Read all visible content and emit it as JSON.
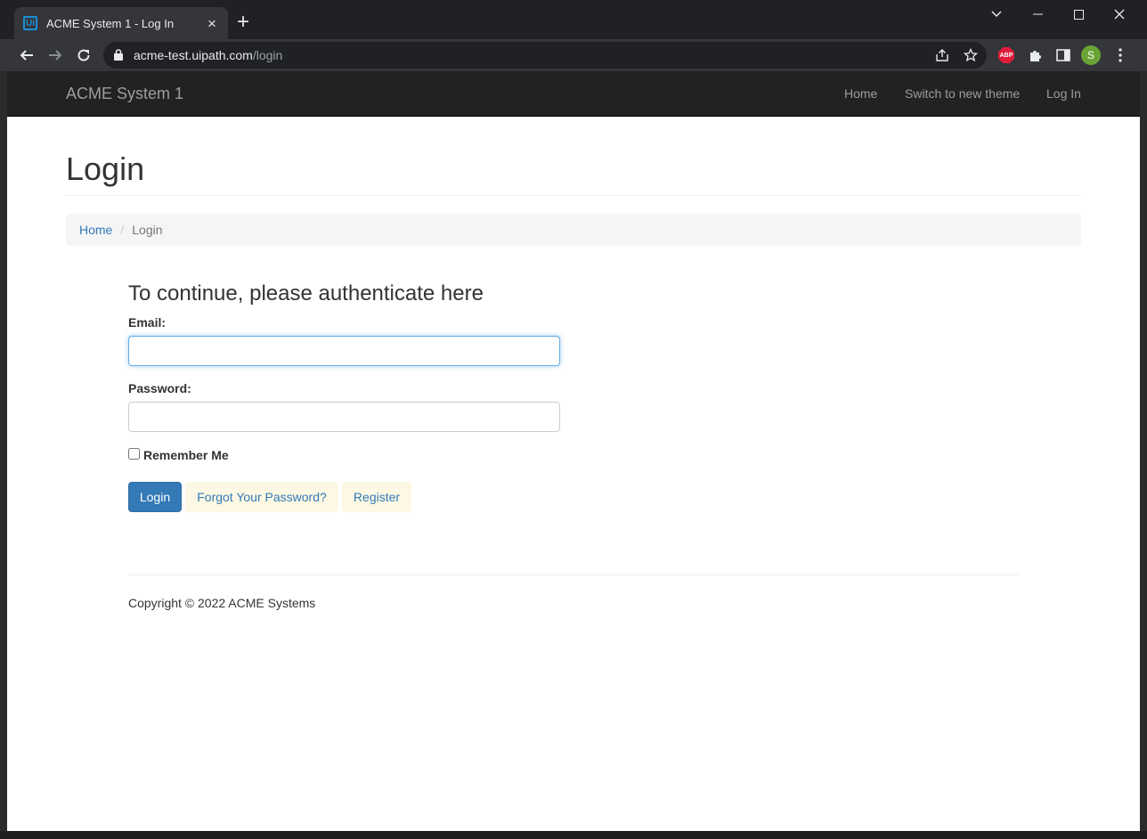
{
  "browser": {
    "tab_title": "ACME System 1 - Log In",
    "tab_favicon_text": "Ui",
    "url_host": "acme-test.uipath.com",
    "url_path": "/login",
    "profile_initial": "S",
    "adblock_label": "ABP"
  },
  "navbar": {
    "brand": "ACME System 1",
    "links": [
      "Home",
      "Switch to new theme",
      "Log In"
    ]
  },
  "page": {
    "title": "Login",
    "breadcrumb": {
      "home": "Home",
      "separator": "/",
      "current": "Login"
    }
  },
  "form": {
    "heading": "To continue, please authenticate here",
    "email_label": "Email:",
    "email_value": "",
    "password_label": "Password:",
    "password_value": "",
    "remember_label": "Remember Me",
    "remember_checked": false,
    "login_button": "Login",
    "forgot_button": "Forgot Your Password?",
    "register_button": "Register"
  },
  "footer": {
    "copyright": "Copyright © 2022 ACME Systems"
  },
  "colors": {
    "navbar_bg": "#222222",
    "primary": "#337ab7",
    "warning_bg": "#fcf8e3",
    "focus_border": "#66afe9"
  }
}
